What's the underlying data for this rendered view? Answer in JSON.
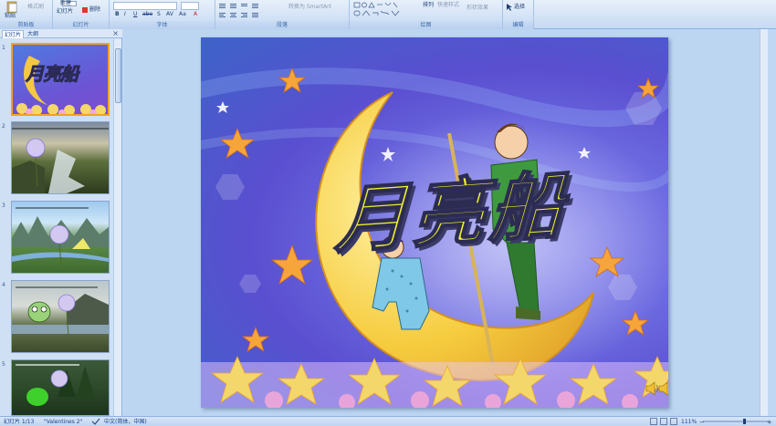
{
  "ribbon": {
    "clipboard": {
      "paste": "粘贴",
      "format_painter": "格式刷",
      "label": "剪贴板"
    },
    "slides": {
      "new_slide_line1": "新建",
      "new_slide_line2": "幻灯片",
      "delete": "删除",
      "label": "幻灯片"
    },
    "font": {
      "label": "字体",
      "bold": "B",
      "italic": "I",
      "underline": "U",
      "strike": "abe",
      "shadow": "S",
      "spacing": "AV",
      "case": "Aa",
      "color": "A"
    },
    "paragraph": {
      "label": "段落",
      "smartart": "转换为 SmartArt"
    },
    "drawing": {
      "label": "绘图",
      "arrange": "排列",
      "quick_styles": "快速样式",
      "shape_effects": "形状效果"
    },
    "editing": {
      "label": "编辑",
      "select": "选择"
    }
  },
  "pane": {
    "tabs": [
      "幻灯片",
      "大纲"
    ],
    "close": "×",
    "thumbnails": [
      {
        "num": "1",
        "title": "月亮船"
      },
      {
        "num": "2"
      },
      {
        "num": "3"
      },
      {
        "num": "4"
      },
      {
        "num": "5"
      }
    ]
  },
  "slide": {
    "title": "月亮船"
  },
  "status": {
    "slide_info": "幻灯片 1/13",
    "theme": "\"Valentines 2\"",
    "language": "中文(简体，中国)",
    "zoom": "111%"
  },
  "colors": {
    "accent": "#f4a21f",
    "title_fill": "#f2f22e",
    "moon": "#f4c842"
  }
}
